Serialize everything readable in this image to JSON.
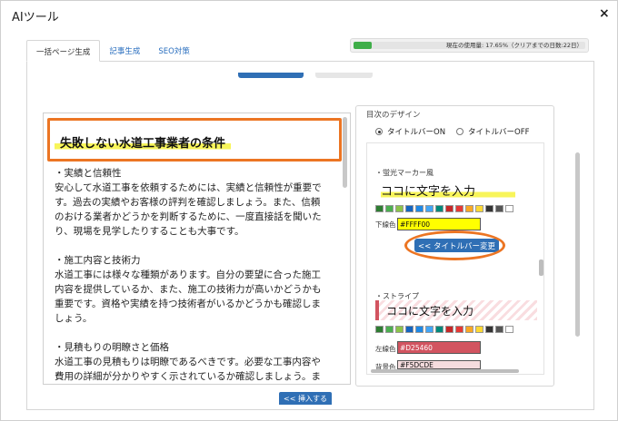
{
  "window": {
    "title": "AIツール",
    "close_glyph": "×"
  },
  "tabs": [
    {
      "label": "一括ページ生成",
      "active": true
    },
    {
      "label": "記事生成",
      "active": false
    },
    {
      "label": "SEO対策",
      "active": false
    }
  ],
  "usage": {
    "text": "現在の使用量: 17.65%（クリアまでの日数:22日）",
    "percent": 17.65
  },
  "editor": {
    "heading": "失敗しない水道工事業者の条件",
    "lines": [
      "・実績と信頼性",
      "安心して水道工事を依頼するためには、実績と信頼性が重要で",
      "す。過去の実績やお客様の評判を確認しましょう。また、信頼",
      "のおける業者かどうかを判断するために、一度直接話を聞いた",
      "り、現場を見学したりすることも大事です。",
      "",
      "・施工内容と技術力",
      "水道工事には様々な種類があります。自分の要望に合った施工",
      "内容を提供しているか、また、施工の技術力が高いかどうかも",
      "重要です。資格や実績を持つ技術者がいるかどうかも確認しま",
      "しょう。",
      "",
      "・見積もりの明瞭さと価格",
      "水道工事の見積もりは明瞭であるべきです。必要な工事内容や",
      "費用の詳細が分かりやすく示されているか確認しましょう。ま"
    ]
  },
  "insert_button": {
    "label": "<< 挿入する"
  },
  "design": {
    "title": "目次のデザイン",
    "radio_on": {
      "label": "タイトルバーON",
      "checked": true
    },
    "radio_off": {
      "label": "タイトルバーOFF",
      "checked": false
    },
    "marker": {
      "section_label": "・蛍光マーカー風",
      "sample_text": "ココに文字を入力",
      "underline_label": "下線色",
      "underline_value": "#FFFF00",
      "change_button": "<< タイトルバー変更"
    },
    "stripe": {
      "section_label": "・ストライプ",
      "sample_text": "ココに文字を入力",
      "left_line_label": "左線色",
      "left_line_value": "#D25460",
      "bg_label": "背景色",
      "bg_value": "#F5DCDE"
    },
    "swatch_colors": [
      "#2e7d32",
      "#4caf50",
      "#8bc34a",
      "#1565c0",
      "#1e88e5",
      "#42a5f5",
      "#00897b",
      "#c62828",
      "#e53935",
      "#f9a825",
      "#fdd835",
      "#333333",
      "#555555",
      "#ffffff"
    ]
  },
  "colors": {
    "accent": "#2f6fb5",
    "highlight_outline": "#ec7523",
    "progress": "#3fae49"
  }
}
